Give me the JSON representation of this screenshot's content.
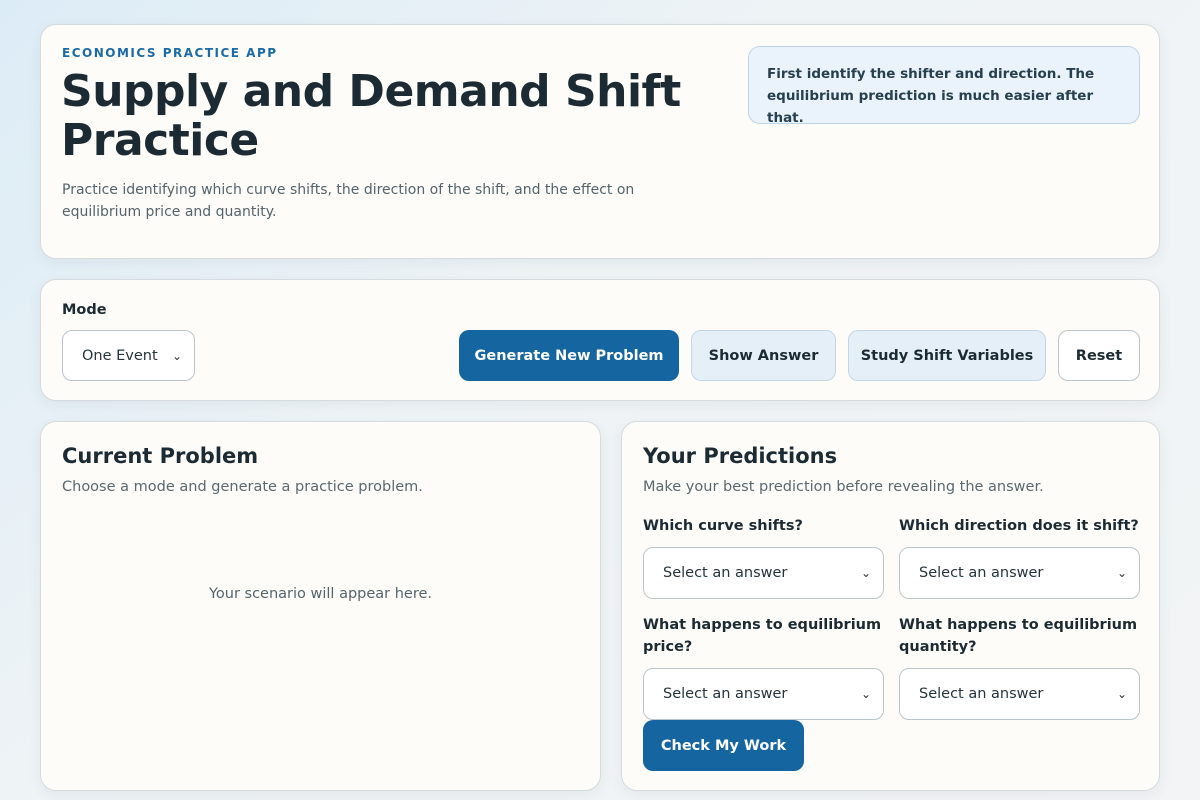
{
  "header": {
    "eyebrow": "ECONOMICS PRACTICE APP",
    "title": "Supply and Demand Shift Practice",
    "subtitle": "Practice identifying which curve shifts, the direction of the shift, and the effect on equilibrium price and quantity.",
    "tip": "First identify the shifter and direction. The equilibrium prediction is much easier after that."
  },
  "toolbar": {
    "mode_label": "Mode",
    "mode_value": "One Event",
    "generate_label": "Generate New Problem",
    "show_answer_label": "Show Answer",
    "study_label": "Study Shift Variables",
    "reset_label": "Reset"
  },
  "problem": {
    "title": "Current Problem",
    "subtitle": "Choose a mode and generate a practice problem.",
    "placeholder": "Your scenario will appear here."
  },
  "predictions": {
    "title": "Your Predictions",
    "subtitle": "Make your best prediction before revealing the answer.",
    "questions": [
      {
        "label": "Which curve shifts?",
        "value": "Select an answer"
      },
      {
        "label": "Which direction does it shift?",
        "value": "Select an answer"
      },
      {
        "label": "What happens to equilibrium price?",
        "value": "Select an answer"
      },
      {
        "label": "What happens to equilibrium quantity?",
        "value": "Select an answer"
      }
    ],
    "check_label": "Check My Work"
  },
  "icons": {
    "select_chevron": "chevron-down-icon"
  },
  "colors": {
    "primary": "#1565a1",
    "eyebrow": "#1a6ba5",
    "card_bg": "#fdfcf8",
    "tip_bg": "#eaf3fb"
  }
}
